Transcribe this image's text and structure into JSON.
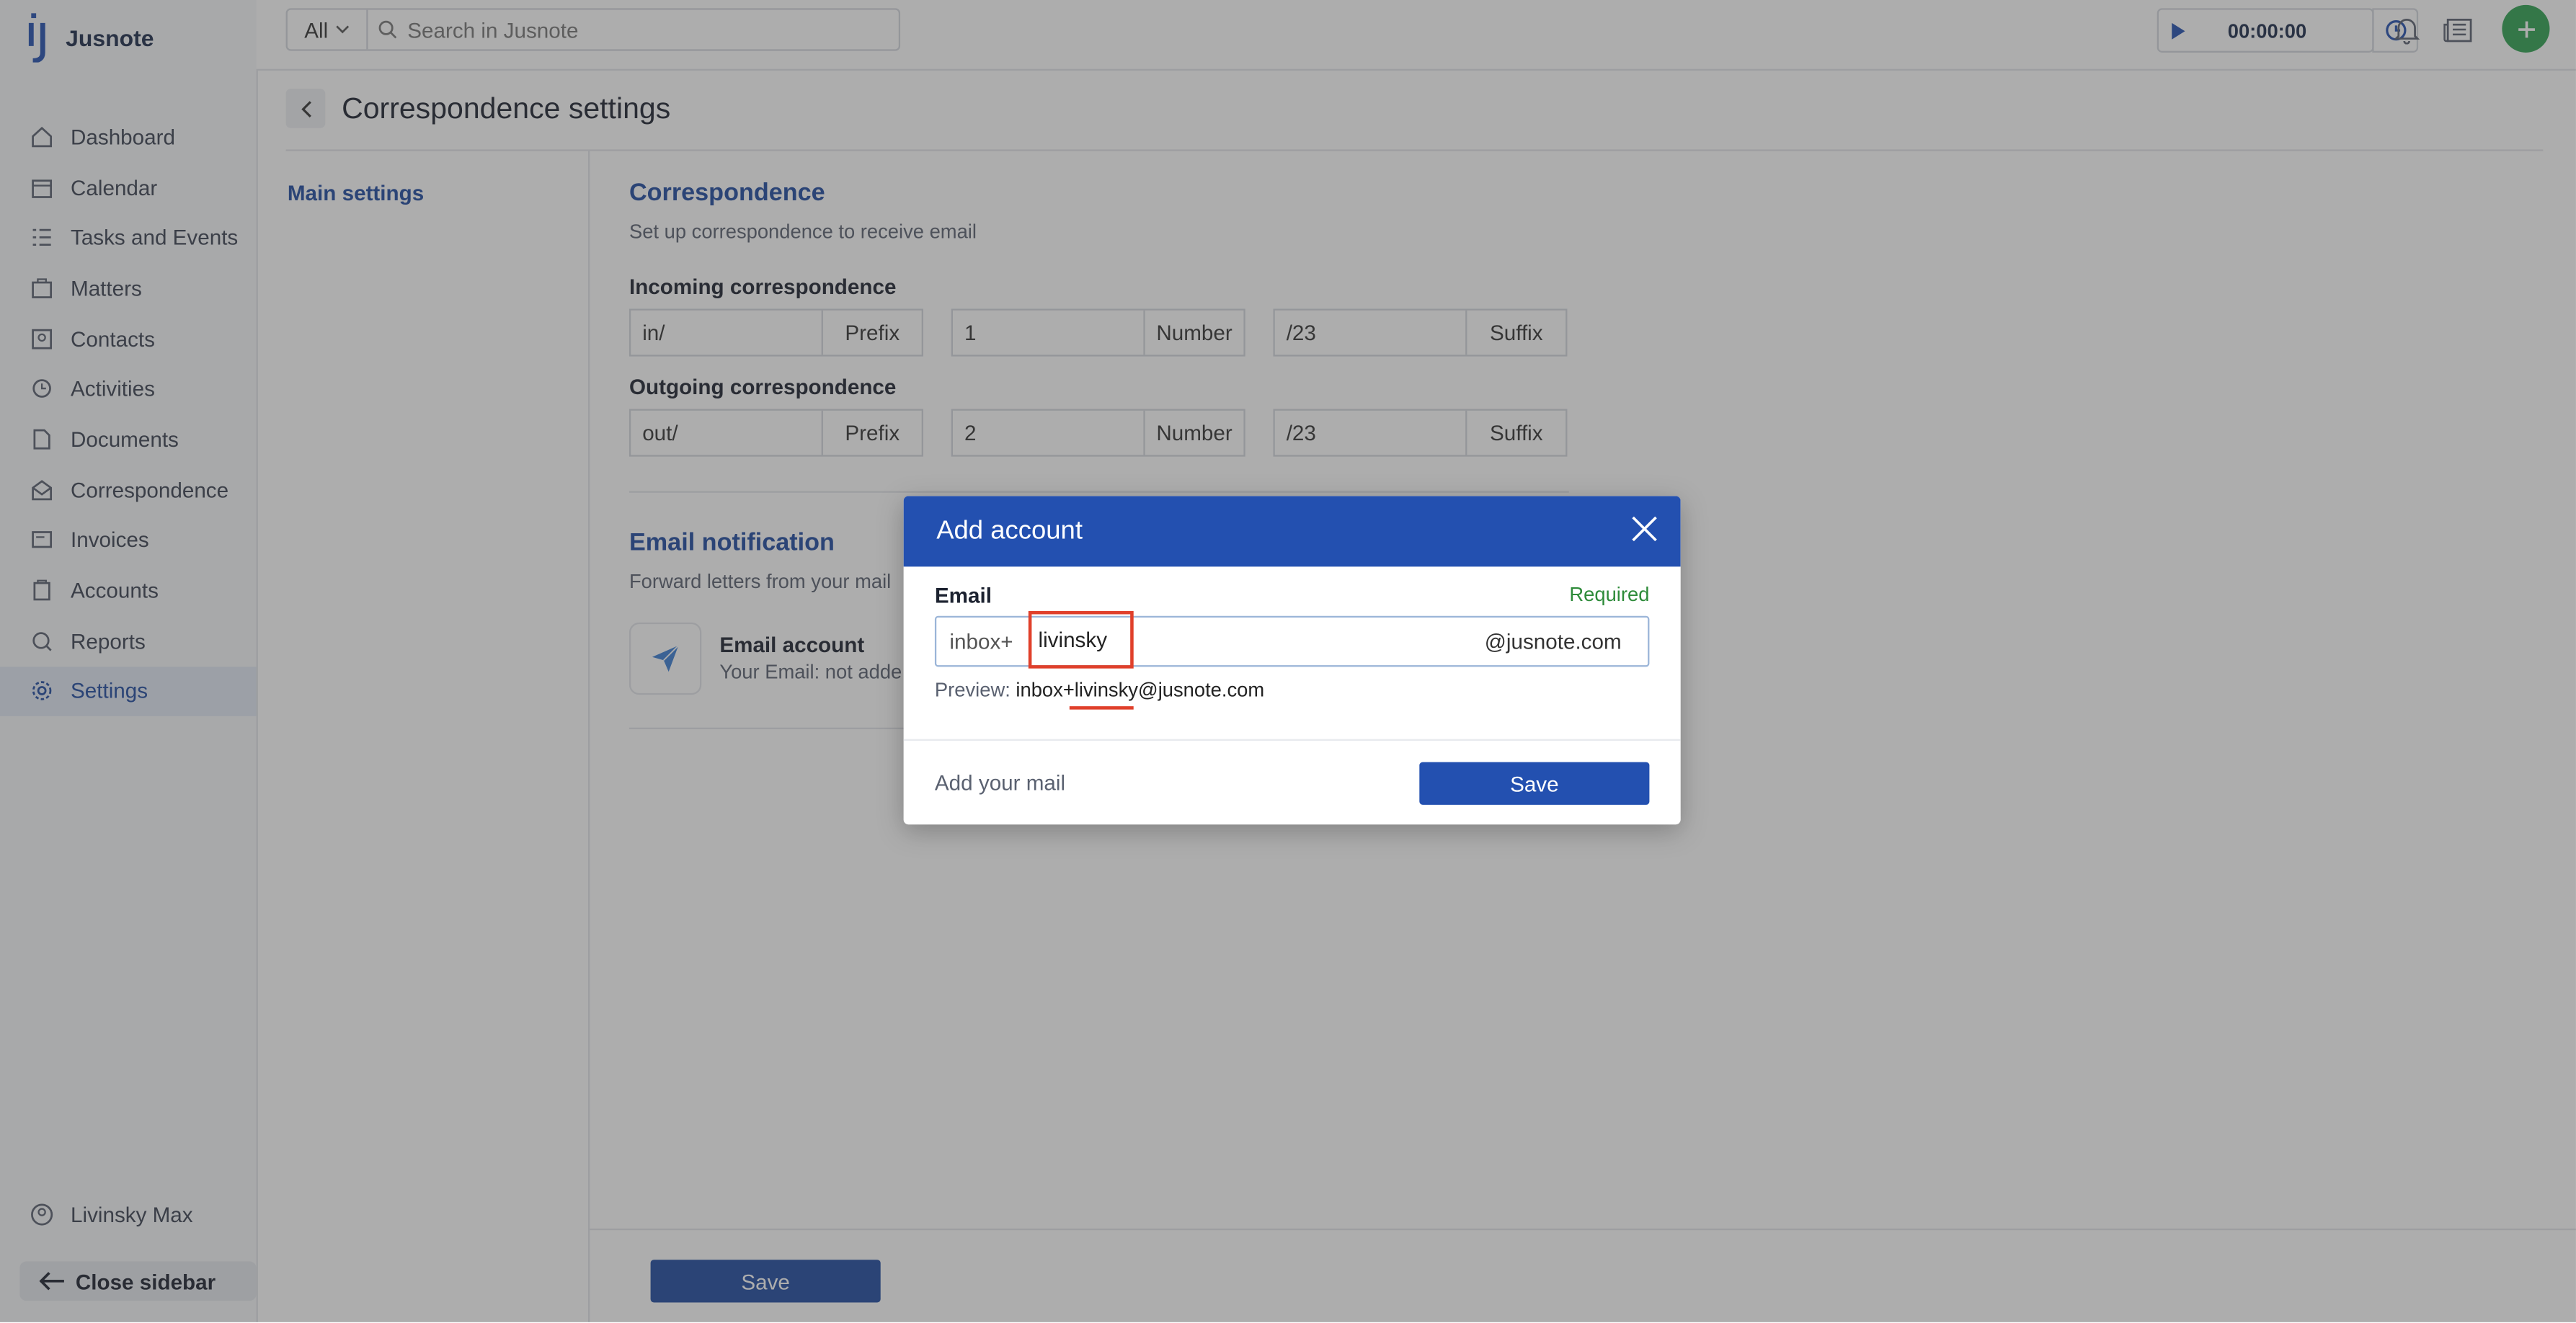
{
  "app": {
    "name": "Jusnote"
  },
  "sidebar": {
    "items": [
      {
        "label": "Dashboard",
        "icon": "home-icon"
      },
      {
        "label": "Calendar",
        "icon": "calendar-icon"
      },
      {
        "label": "Tasks and Events",
        "icon": "tasks-icon"
      },
      {
        "label": "Matters",
        "icon": "briefcase-icon"
      },
      {
        "label": "Contacts",
        "icon": "contacts-icon"
      },
      {
        "label": "Activities",
        "icon": "activities-icon"
      },
      {
        "label": "Documents",
        "icon": "documents-icon"
      },
      {
        "label": "Correspondence",
        "icon": "mail-icon"
      },
      {
        "label": "Invoices",
        "icon": "invoice-icon"
      },
      {
        "label": "Accounts",
        "icon": "accounts-icon"
      },
      {
        "label": "Reports",
        "icon": "reports-icon"
      },
      {
        "label": "Settings",
        "icon": "gear-icon",
        "active": true
      }
    ],
    "user": "Livinsky Max",
    "close_label": "Close sidebar"
  },
  "topbar": {
    "scope": "All",
    "search_placeholder": "Search in Jusnote",
    "timer": "00:00:00"
  },
  "page": {
    "title": "Correspondence settings",
    "subnav": "Main settings",
    "correspondence": {
      "title": "Correspondence",
      "subtitle": "Set up correspondence to receive email",
      "incoming_label": "Incoming correspondence",
      "incoming": {
        "prefix": "in/",
        "prefix_label": "Prefix",
        "number": "1",
        "number_label": "Number",
        "suffix": "/23",
        "suffix_label": "Suffix"
      },
      "outgoing_label": "Outgoing correspondence",
      "outgoing": {
        "prefix": "out/",
        "prefix_label": "Prefix",
        "number": "2",
        "number_label": "Number",
        "suffix": "/23",
        "suffix_label": "Suffix"
      }
    },
    "notification": {
      "title": "Email notification",
      "subtitle": "Forward letters from your mail",
      "account_title": "Email account",
      "account_sub": "Your Email:  not adde"
    },
    "save_label": "Save"
  },
  "modal": {
    "title": "Add account",
    "email_label": "Email",
    "required": "Required",
    "prefix": "inbox+",
    "username": "livinsky",
    "domain": "@jusnote.com",
    "preview_label": "Preview:",
    "preview_value": "inbox+livinsky@jusnote.com",
    "add_mail": "Add your mail",
    "save": "Save"
  },
  "colors": {
    "accent": "#2350b0",
    "success": "#2fa351",
    "highlight": "#e0402b"
  }
}
